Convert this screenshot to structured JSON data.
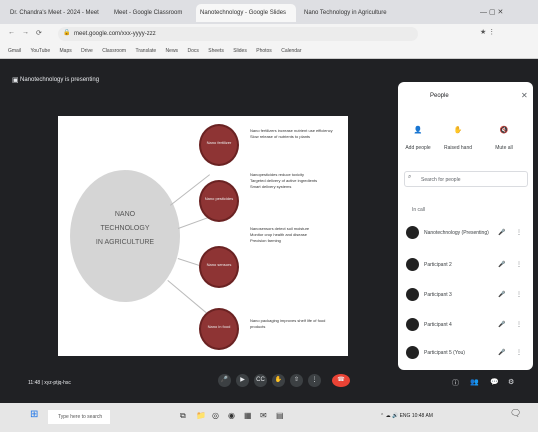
{
  "browser": {
    "tabs": [
      {
        "label": "Dr. Chandra's Meet - 2024 - Meet",
        "active": false
      },
      {
        "label": "Meet - Google Classroom",
        "active": false
      },
      {
        "label": "Nanotechnology - Google Slides",
        "active": true
      },
      {
        "label": "Nano Technology in Agriculture",
        "active": false
      }
    ],
    "url": "meet.google.com/xxx-yyyy-zzz",
    "bookmarks": [
      "Gmail",
      "YouTube",
      "Maps",
      "Drive",
      "Classroom",
      "Translate",
      "News",
      "Docs",
      "Sheets",
      "Slides",
      "Photos",
      "Calendar"
    ]
  },
  "meet": {
    "title": "Nanotechnology is presenting",
    "time": "11:48",
    "meeting_code": "xyz-ptjq-hsc",
    "controls": [
      "mic-icon",
      "camera-icon",
      "captions-icon",
      "hand-icon",
      "present-icon",
      "more-icon",
      "end-call-icon"
    ]
  },
  "slide": {
    "center_text": [
      "NANO",
      "TECHNOLOGY",
      "IN AGRICULTURE"
    ],
    "nodes": [
      "Nano fertilizer",
      "Nano pesticides",
      "Nano sensors",
      "Nano in food"
    ],
    "bullets": [
      [
        "Nano fertilizers increase nutrient use efficiency",
        "Slow release of nutrients to plants"
      ],
      [
        "Nanopesticides reduce toxicity",
        "Targeted delivery of active ingredients",
        "Smart delivery systems"
      ],
      [
        "Nanosensors detect soil moisture",
        "Monitor crop health and disease",
        "Precision farming"
      ],
      [
        "Nano packaging improves shelf life of food products"
      ]
    ]
  },
  "people_panel": {
    "title": "People",
    "actions": [
      {
        "icon": "add-person-icon",
        "label": "Add people"
      },
      {
        "icon": "hand-icon",
        "label": "Raised hand"
      },
      {
        "icon": "mute-icon",
        "label": "Mute all"
      }
    ],
    "search_placeholder": "Search for people",
    "section": "In call",
    "participants": [
      {
        "name": "Nanotechnology (Presenting)",
        "mic": "mic-icon"
      },
      {
        "name": "Participant 2",
        "mic": "mic-off-icon"
      },
      {
        "name": "Participant 3",
        "mic": "mic-off-icon"
      },
      {
        "name": "Participant 4",
        "mic": "mic-off-icon"
      },
      {
        "name": "Participant 5 (You)",
        "mic": "mic-off-icon"
      }
    ]
  },
  "taskbar": {
    "search_placeholder": "Type here to search",
    "tray_time": "10:48 AM"
  },
  "colors": {
    "meet_bg": "#202124",
    "node": "#8e3434",
    "end_call": "#ea4335"
  }
}
